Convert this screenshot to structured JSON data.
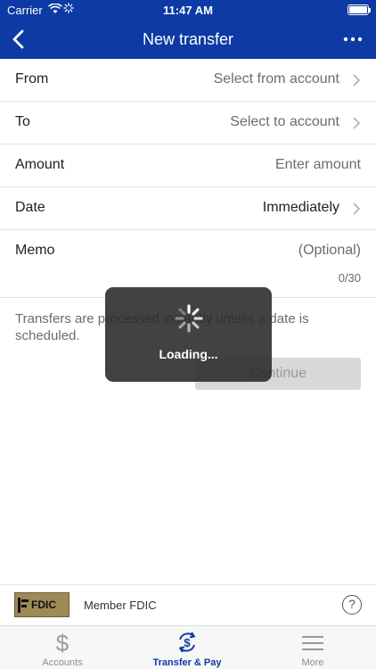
{
  "status_bar": {
    "carrier": "Carrier",
    "time": "11:47 AM"
  },
  "nav": {
    "title": "New transfer",
    "back_icon": "chevron-left-icon",
    "more_icon": "ellipsis-icon"
  },
  "form": {
    "from": {
      "label": "From",
      "value": "Select from account"
    },
    "to": {
      "label": "To",
      "value": "Select to account"
    },
    "amount": {
      "label": "Amount",
      "placeholder": "Enter amount"
    },
    "date": {
      "label": "Date",
      "value": "Immediately"
    },
    "memo": {
      "label": "Memo",
      "placeholder": "(Optional)",
      "counter": "0/30"
    }
  },
  "info_text": "Transfers are processed instantly unless a date is scheduled.",
  "continue_label": "Continue",
  "loading": {
    "text": "Loading..."
  },
  "footer": {
    "logo_text": "FDIC",
    "member_text": "Member FDIC",
    "help_label": "?"
  },
  "tabs": [
    {
      "label": "Accounts",
      "icon": "dollar-icon",
      "active": false
    },
    {
      "label": "Transfer & Pay",
      "icon": "transfer-pay-icon",
      "active": true
    },
    {
      "label": "More",
      "icon": "menu-icon",
      "active": false
    }
  ],
  "colors": {
    "brand": "#0d3aa4",
    "disabled_button": "#d8d8d8",
    "overlay": "#282828"
  }
}
